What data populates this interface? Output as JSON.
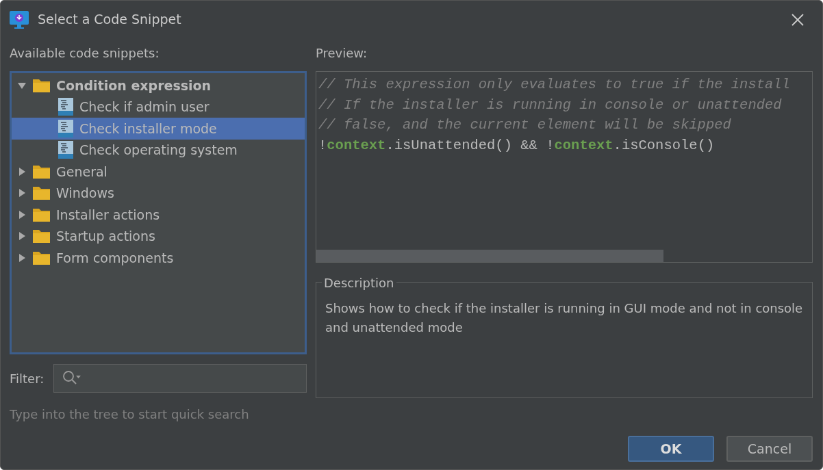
{
  "window": {
    "title": "Select a Code Snippet"
  },
  "tree": {
    "label": "Available code snippets:",
    "items": [
      {
        "label": "Condition expression",
        "expanded": true,
        "selected": false,
        "children": [
          {
            "label": "Check if admin user",
            "selected": false
          },
          {
            "label": "Check installer mode",
            "selected": true
          },
          {
            "label": "Check operating system",
            "selected": false
          }
        ]
      },
      {
        "label": "General",
        "expanded": false,
        "selected": false
      },
      {
        "label": "Windows",
        "expanded": false,
        "selected": false
      },
      {
        "label": "Installer actions",
        "expanded": false,
        "selected": false
      },
      {
        "label": "Startup actions",
        "expanded": false,
        "selected": false
      },
      {
        "label": "Form components",
        "expanded": false,
        "selected": false
      }
    ]
  },
  "filter": {
    "label": "Filter:"
  },
  "hint": "Type into the tree to start quick search",
  "preview": {
    "label": "Preview:",
    "lines": [
      [
        {
          "kind": "comment",
          "text": "// This expression only evaluates to true if the install"
        }
      ],
      [
        {
          "kind": "comment",
          "text": "// If the installer is running in console or unattended"
        }
      ],
      [
        {
          "kind": "comment",
          "text": "// false, and the current element will be skipped"
        }
      ],
      [
        {
          "kind": "plain",
          "text": "!"
        },
        {
          "kind": "keyword",
          "text": "context"
        },
        {
          "kind": "plain",
          "text": ".isUnattended() && !"
        },
        {
          "kind": "keyword",
          "text": "context"
        },
        {
          "kind": "plain",
          "text": ".isConsole()"
        }
      ]
    ]
  },
  "description": {
    "label": "Description",
    "text": "Shows how to check if the installer is running in GUI mode and not in console and unattended mode"
  },
  "buttons": [
    {
      "label": "OK",
      "kind": "primary"
    },
    {
      "label": "Cancel",
      "kind": "secondary"
    }
  ]
}
